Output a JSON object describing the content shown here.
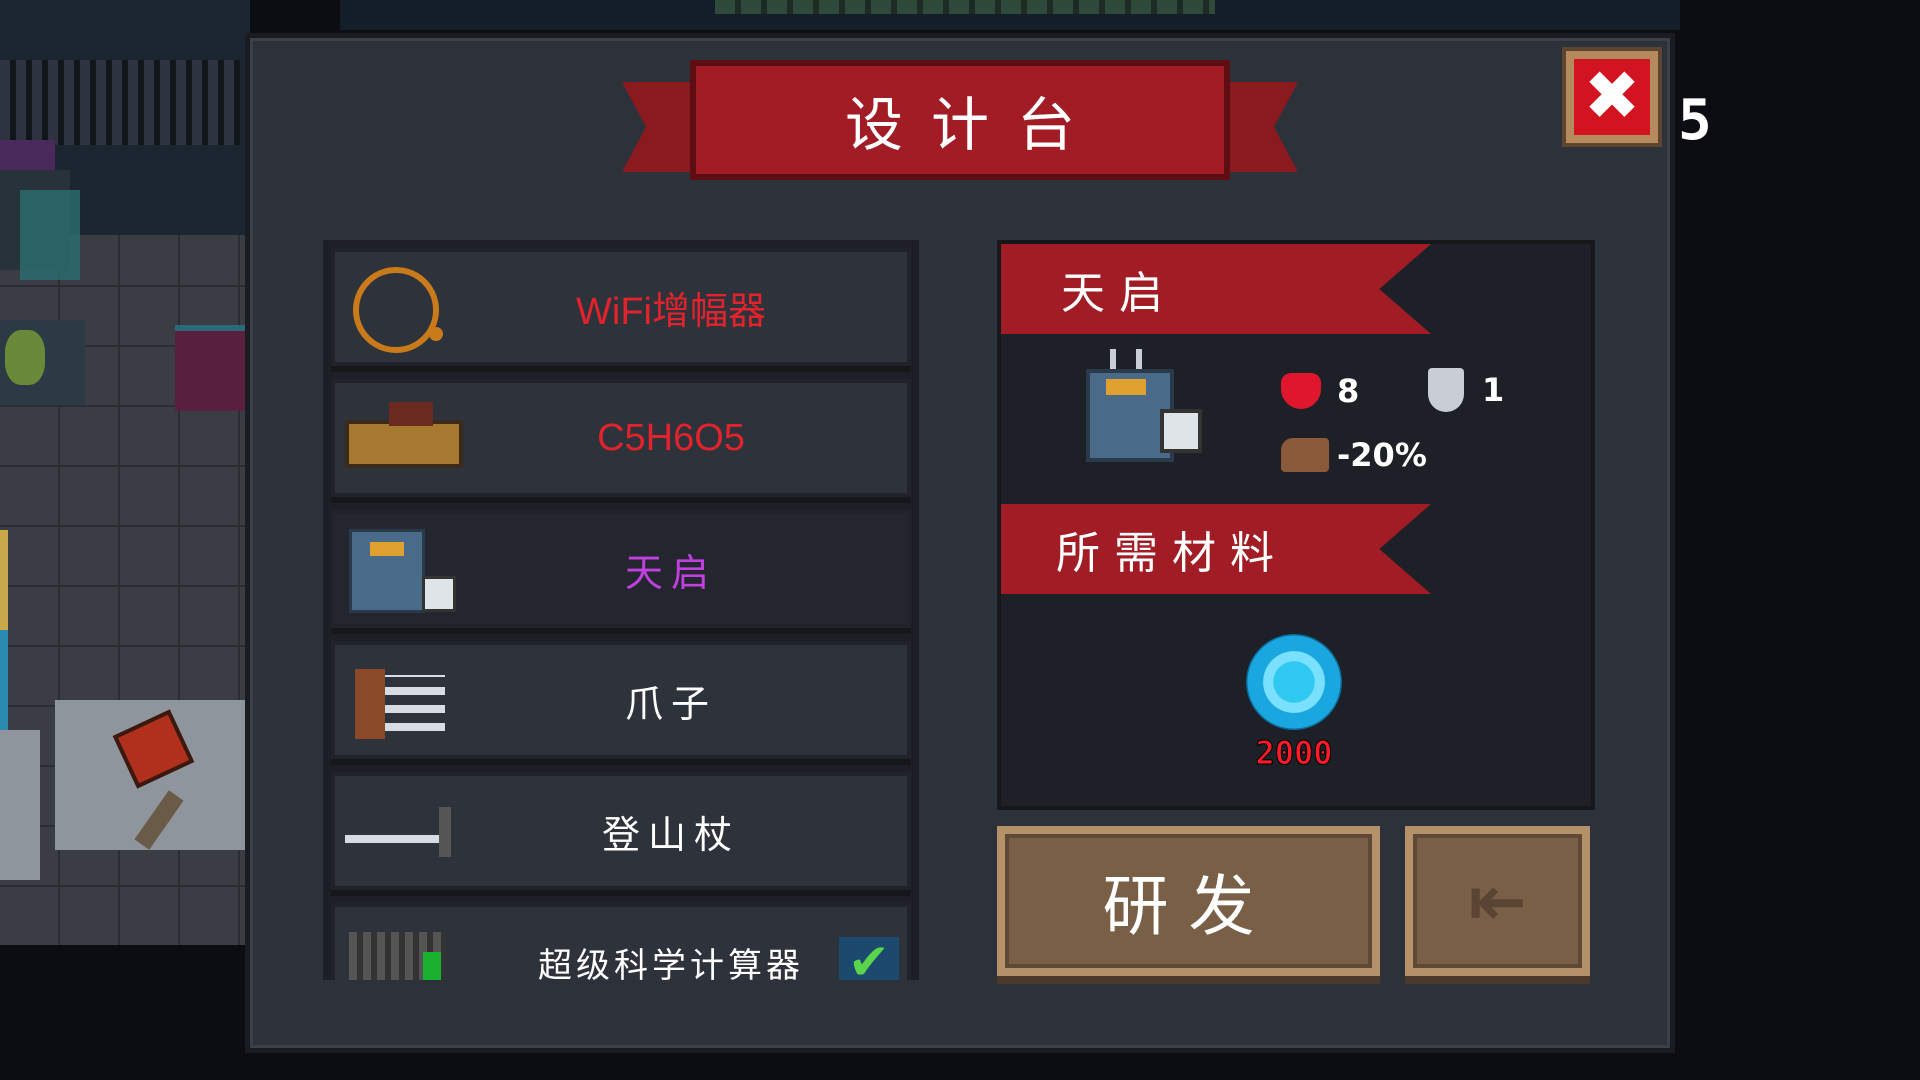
{
  "counter": "5",
  "header": {
    "title": "设计台"
  },
  "close_button": {
    "label": "✖"
  },
  "items": [
    {
      "name": "WiFi增幅器",
      "color": "#e0232c",
      "icon": "wifi-amplifier-ring-icon",
      "selected": false,
      "crafted": false
    },
    {
      "name": "C5H6O5",
      "color": "#e0232c",
      "icon": "c5h6o5-gun-icon",
      "selected": false,
      "crafted": false
    },
    {
      "name": "天启",
      "color": "#c040e0",
      "icon": "apocalypse-mech-icon",
      "selected": true,
      "crafted": false
    },
    {
      "name": "爪子",
      "color": "#ffffff",
      "icon": "claw-icon",
      "selected": false,
      "crafted": false
    },
    {
      "name": "登山杖",
      "color": "#ffffff",
      "icon": "hiking-stick-icon",
      "selected": false,
      "crafted": false
    },
    {
      "name": "超级科学计算器",
      "color": "#ffffff",
      "icon": "calculator-icon",
      "selected": false,
      "crafted": true
    }
  ],
  "detail": {
    "name": "天启",
    "icon": "apocalypse-mech-icon",
    "health": "8",
    "armor": "1",
    "speed": "-20%",
    "materials_title": "所需材料",
    "materials": [
      {
        "icon": "blue-gem-icon",
        "count": "2000"
      }
    ]
  },
  "buttons": {
    "develop": "研发",
    "exit_icon": "exit-door-icon"
  }
}
